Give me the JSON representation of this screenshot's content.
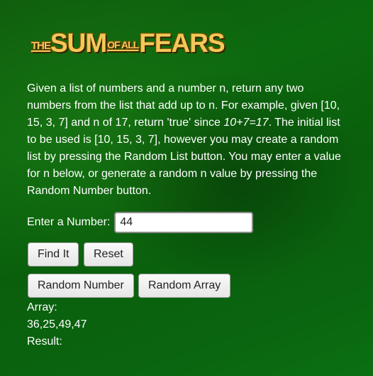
{
  "logo": {
    "the": "THE",
    "sum": "SUM",
    "of_all": "OF ALL",
    "fears": "FEARS"
  },
  "description": {
    "part1": "Given a list of numbers and a number n, return any two numbers from the list that add up to n. For example, given [10, 15, 3, 7] and n of 17, return 'true' since ",
    "equation": "10+7=17",
    "part2": ". The initial list to be used is [10, 15, 3, 7], however you may create a random list by pressing the Random List button. You may enter a value for n below, or generate a random n value by pressing the Random Number button."
  },
  "input": {
    "label": "Enter a Number:",
    "value": "44"
  },
  "buttons": {
    "find": "Find It",
    "reset": "Reset",
    "random_number": "Random Number",
    "random_array": "Random Array"
  },
  "output": {
    "array_label": "Array:",
    "array_value": "36,25,49,47",
    "result_label": "Result:"
  }
}
